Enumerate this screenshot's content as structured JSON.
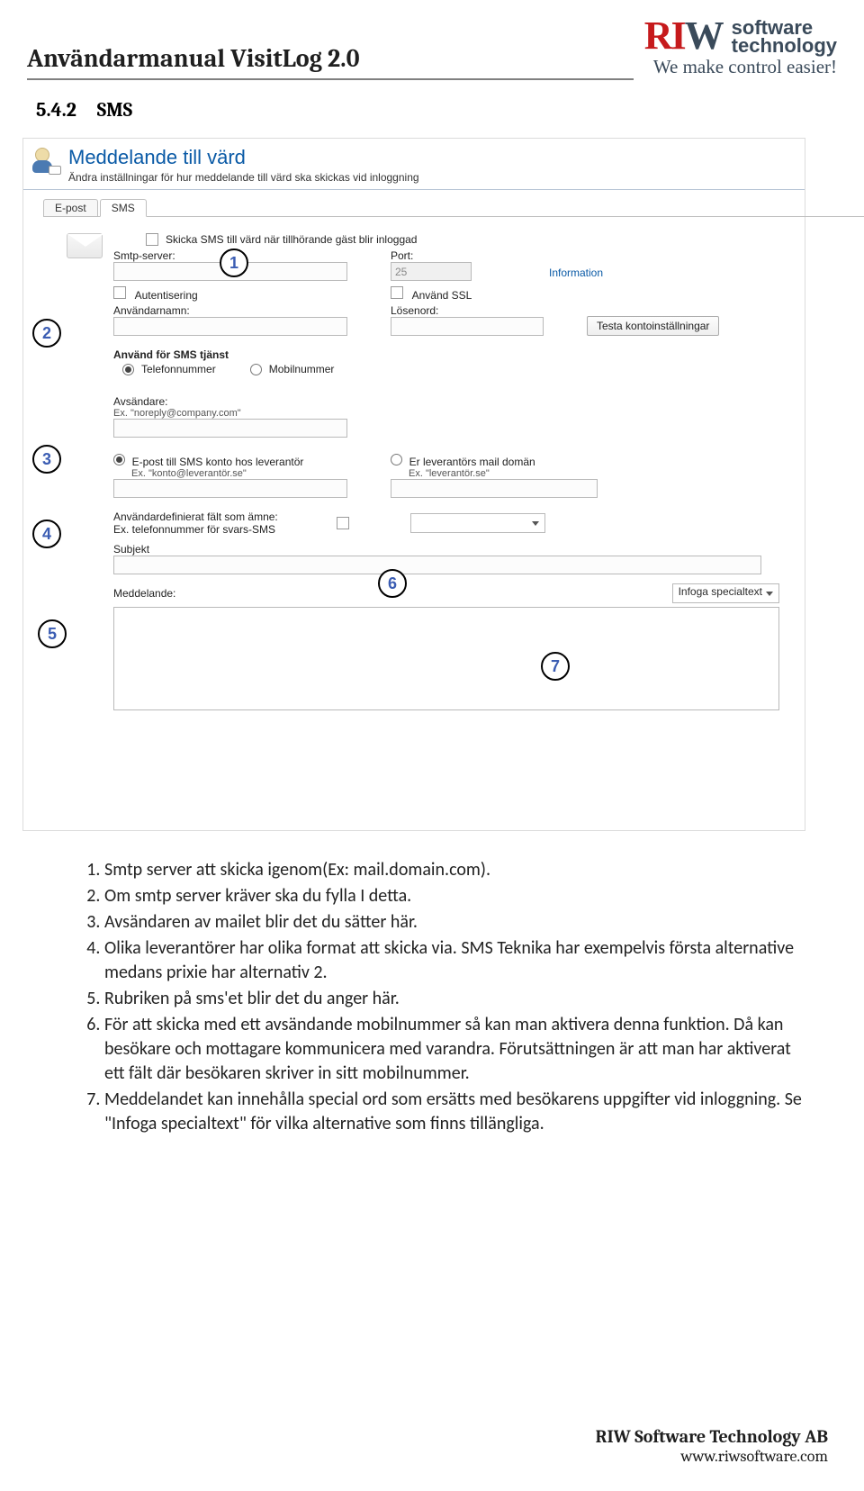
{
  "doc": {
    "title": "Användarmanual VisitLog 2.0",
    "section_number": "5.4.2",
    "section_title": "SMS",
    "footer_company": "RIW Software Technology AB",
    "footer_url": "www.riwsoftware.com"
  },
  "logo": {
    "line1": "software",
    "line2": "technology",
    "tagline": "We make control easier!"
  },
  "screenshot": {
    "title": "Meddelande till värd",
    "subtitle": "Ändra inställningar för hur meddelande till värd ska skickas vid inloggning",
    "tabs": {
      "email": "E-post",
      "sms": "SMS"
    },
    "labels": {
      "send_sms_on_login": "Skicka SMS till värd när tillhörande gäst blir inloggad",
      "smtp_server": "Smtp-server:",
      "port": "Port:",
      "information": "Information",
      "authentication": "Autentisering",
      "use_ssl": "Använd SSL",
      "username": "Användarnamn:",
      "password": "Lösenord:",
      "test_button": "Testa kontoinställningar",
      "use_for_sms": "Använd för SMS tjänst",
      "phone": "Telefonnummer",
      "mobile": "Mobilnummer",
      "sender": "Avsändare:",
      "sender_hint": "Ex. \"noreply@company.com\"",
      "opt_email_to_sms": "E-post till SMS konto hos leverantör",
      "opt_email_to_sms_hint": "Ex. \"konto@leverantör.se\"",
      "opt_mail_domain": "Er leverantörs mail domän",
      "opt_mail_domain_hint": "Ex. \"leverantör.se\"",
      "custom_field_l1": "Användardefinierat fält som ämne:",
      "custom_field_l2": "Ex. telefonnummer för svars-SMS",
      "subject": "Subjekt",
      "message": "Meddelande:",
      "insert_special": "Infoga specialtext"
    },
    "values": {
      "port": "25",
      "smtp_server": "",
      "username": "",
      "password": "",
      "sender": "",
      "provider_email": "",
      "provider_domain": "",
      "subject": "",
      "custom_select": ""
    }
  },
  "markers": [
    "1",
    "2",
    "3",
    "4",
    "5",
    "6",
    "7"
  ],
  "instructions": {
    "items": [
      "Smtp server att skicka igenom(Ex: mail.domain.com).",
      "Om smtp server kräver ska du fylla I detta.",
      "Avsändaren av mailet blir det du sätter här.",
      "Olika leverantörer har olika format att skicka via. SMS Teknika har exempelvis första alternative medans prixie har alternativ 2.",
      "Rubriken på sms'et blir det du anger här.",
      "För att skicka med ett avsändande mobilnummer så kan man aktivera denna funktion. Då kan besökare och mottagare kommunicera med varandra. Förutsättningen är att man har aktiverat ett fält där besökaren skriver in sitt mobilnummer.",
      "Meddelandet kan innehålla special ord som ersätts med besökarens uppgifter vid inloggning. Se \"Infoga specialtext\" för vilka alternative som finns tillängliga."
    ]
  }
}
